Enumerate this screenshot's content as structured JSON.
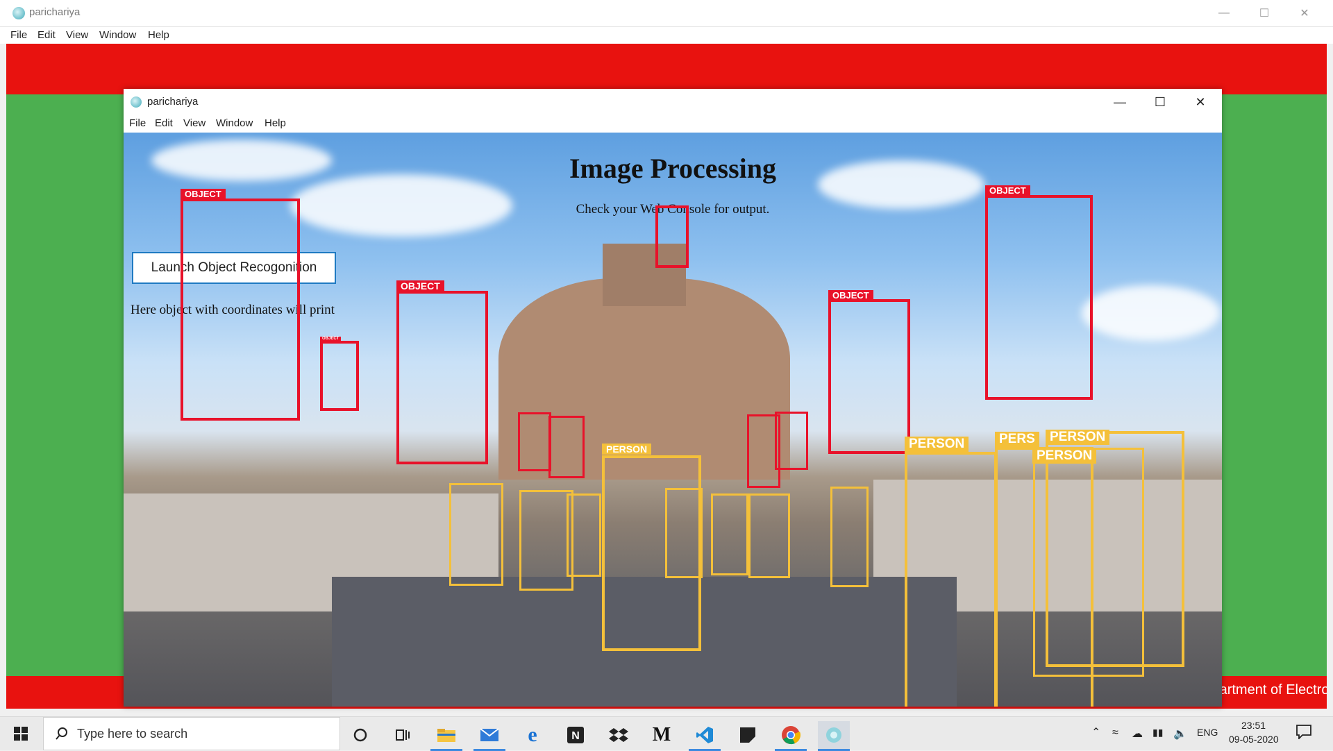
{
  "outer_window": {
    "title": "parichariya",
    "menu": [
      "File",
      "Edit",
      "View",
      "Window",
      "Help"
    ]
  },
  "inner_window": {
    "title": "parichariya",
    "menu": [
      "File",
      "Edit",
      "View",
      "Window",
      "Help"
    ]
  },
  "page": {
    "heading": "Image Processing",
    "subtext": "Check your Web Console for output.",
    "launch_button": "Launch Object Recogonition",
    "output_text": "Here object with coordinates will print"
  },
  "detections": {
    "object_label": "OBJECT",
    "person_label": "PERSON",
    "pers_label": "PERS"
  },
  "footer": {
    "marquee": "It is gladdening to thank Humanitarian Technology Labs and the Department of Electro"
  },
  "taskbar": {
    "search_placeholder": "Type here to search",
    "language": "ENG",
    "time": "23:51",
    "date": "09-05-2020"
  },
  "colors": {
    "app_bg": "#4caf50",
    "banner": "#e8120f",
    "object_box": "#e8122a",
    "person_box": "#f4c03a",
    "button_border": "#1f7ac2"
  }
}
